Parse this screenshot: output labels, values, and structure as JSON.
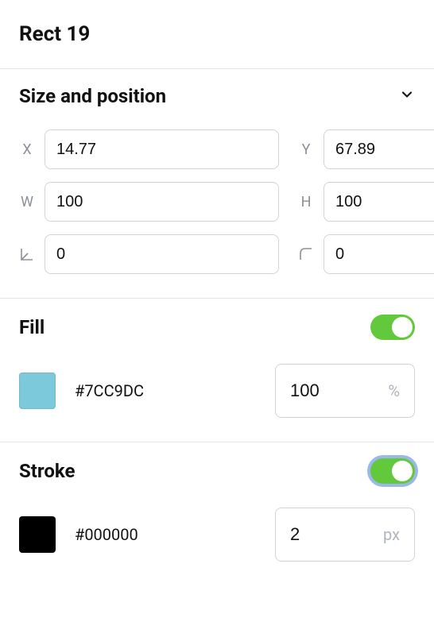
{
  "object": {
    "name": "Rect 19"
  },
  "sizePosition": {
    "label": "Size and position",
    "x": {
      "label": "X",
      "value": "14.77"
    },
    "y": {
      "label": "Y",
      "value": "67.89"
    },
    "w": {
      "label": "W",
      "value": "100"
    },
    "h": {
      "label": "H",
      "value": "100"
    },
    "rotation": {
      "value": "0"
    },
    "cornerRadius": {
      "value": "0"
    }
  },
  "fill": {
    "label": "Fill",
    "enabled": true,
    "color": "#7CC9DC",
    "colorLabel": "#7CC9DC",
    "opacity": "100",
    "opacityUnit": "%"
  },
  "stroke": {
    "label": "Stroke",
    "enabled": true,
    "color": "#000000",
    "colorLabel": "#000000",
    "width": "2",
    "widthUnit": "px"
  }
}
